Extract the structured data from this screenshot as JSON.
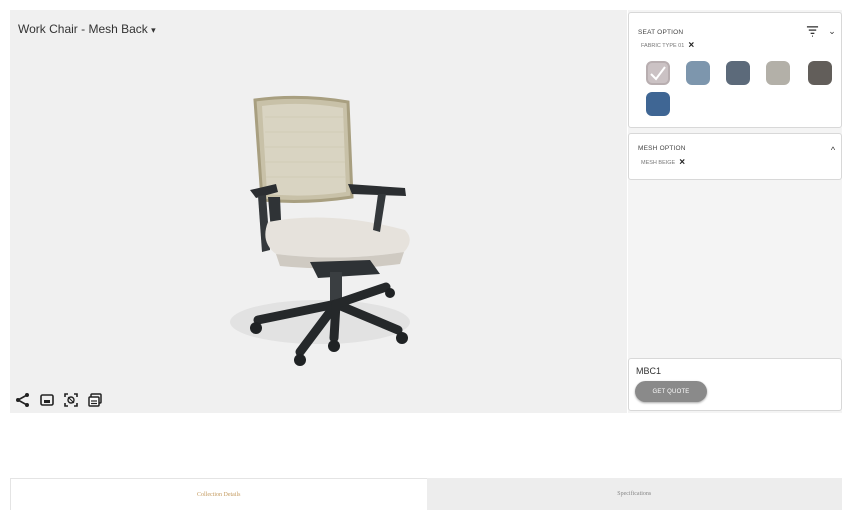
{
  "viewer": {
    "title": "Work Chair - Mesh Back",
    "title_caret": "▾",
    "toolbar": [
      "share-icon",
      "image-icon",
      "ar-scan-icon",
      "gallery-icon"
    ]
  },
  "seat_option": {
    "title": "SEAT OPTION",
    "selected_chip": "FABRIC TYPE 01",
    "swatches": [
      "#cbc2c4",
      "#7d96ad",
      "#5c6a7a",
      "#b3b0a8",
      "#625e5a",
      "#3f6694"
    ],
    "selected_index": 0
  },
  "mesh_option": {
    "title": "MESH OPTION",
    "selected_chip": "MESH BEIGE",
    "caret": "^"
  },
  "quote": {
    "code": "MBC1",
    "button": "GET QUOTE"
  },
  "tabs": [
    "Collection Details",
    "Specifications"
  ],
  "colors": {
    "viewer_bg": "#f0f0f0",
    "accent_tab": "#c49b60",
    "button_gray": "#8a8a8a"
  }
}
